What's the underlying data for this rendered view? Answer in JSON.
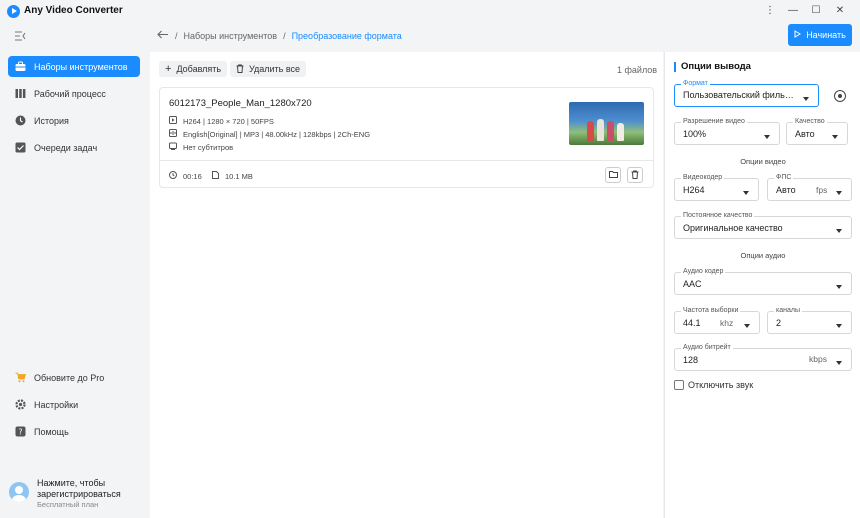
{
  "app": {
    "title": "Any Video Converter"
  },
  "window_controls": {
    "more": "⋮",
    "minimize": "—",
    "maximize": "☐",
    "close": "✕"
  },
  "sidebar": {
    "items": [
      {
        "label": "Наборы инструментов",
        "icon": "toolbox-icon",
        "active": true
      },
      {
        "label": "Рабочий процесс",
        "icon": "workflow-icon",
        "active": false
      },
      {
        "label": "История",
        "icon": "history-icon",
        "active": false
      },
      {
        "label": "Очереди задач",
        "icon": "task-queue-icon",
        "active": false
      }
    ],
    "bottom_items": [
      {
        "label": "Обновите до Pro",
        "icon": "cart-icon"
      },
      {
        "label": "Настройки",
        "icon": "gear-icon"
      },
      {
        "label": "Помощь",
        "icon": "help-icon"
      }
    ],
    "user": {
      "register_text": "Нажмите, чтобы зарегистрироваться",
      "plan": "Бесплатный план"
    }
  },
  "header": {
    "breadcrumb": {
      "parent": "Наборы инструментов",
      "separator": "/",
      "current": "Преобразование формата"
    },
    "start_label": "Начинать"
  },
  "toolbar": {
    "add_label": "Добавлять",
    "delete_all_label": "Удалить все",
    "file_count": "1 файлов"
  },
  "file": {
    "name": "6012173_People_Man_1280x720",
    "video_info": "H264 | 1280 × 720 | 50FPS",
    "audio_info": "English[Original] | MP3 | 48.00kHz | 128kbps | 2Ch-ENG",
    "subtitle_info": "Нет субтитров",
    "duration": "00:16",
    "size": "10.1 MB"
  },
  "output": {
    "title": "Опции вывода",
    "format": {
      "label": "Формат",
      "value": "Пользовательский филь…"
    },
    "resolution": {
      "label": "Разрешение видео",
      "value": "100%"
    },
    "quality": {
      "label": "Качество",
      "value": "Авто"
    },
    "video_section": "Опции видео",
    "video_codec": {
      "label": "Видеокодер",
      "value": "H264"
    },
    "fps": {
      "label": "ФПС",
      "value": "Авто",
      "unit": "fps"
    },
    "constant_quality": {
      "label": "Постоянное качество",
      "value": "Оригинальное качество"
    },
    "audio_section": "Опции аудио",
    "audio_codec": {
      "label": "Аудио кодер",
      "value": "AAC"
    },
    "sample_rate": {
      "label": "Частота выборки",
      "value": "44.1",
      "unit": "khz"
    },
    "channels": {
      "label": "каналы",
      "value": "2"
    },
    "audio_bitrate": {
      "label": "Аудио битрейт",
      "value": "128",
      "unit": "kbps"
    },
    "mute": {
      "label": "Отключить звук",
      "checked": false
    }
  },
  "colors": {
    "accent": "#1a8cff"
  }
}
